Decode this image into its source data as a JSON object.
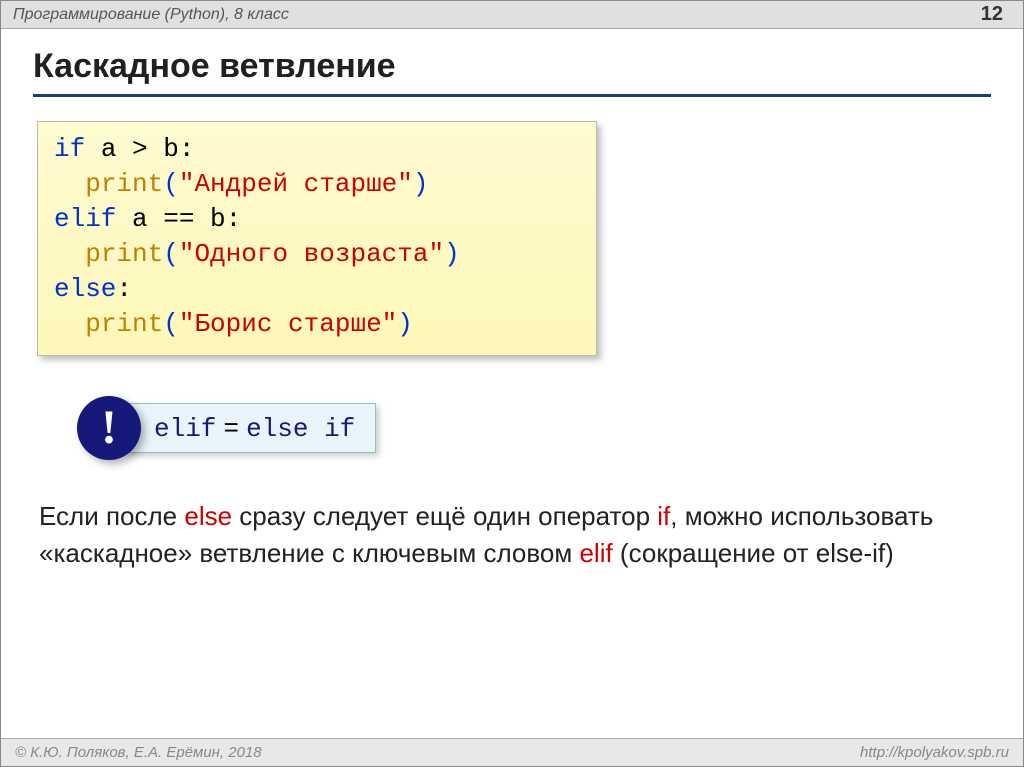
{
  "header": {
    "title": "Программирование (Python), 8 класс",
    "page": "12"
  },
  "title": "Каскадное ветвление",
  "code": {
    "l1_kw": "if",
    "l1_rest": " a > b:",
    "l2_fn": "print",
    "l2_p1": "(",
    "l2_str": "\"Андрей старше\"",
    "l2_p2": ")",
    "l3_kw": "elif",
    "l3_rest": " a == b:",
    "l4_fn": "print",
    "l4_p1": "(",
    "l4_str": "\"Одного возраста\"",
    "l4_p2": ")",
    "l5_kw": "else",
    "l5_rest": ":",
    "l6_fn": "print",
    "l6_p1": "(",
    "l6_str": "\"Борис старше\"",
    "l6_p2": ")"
  },
  "note": {
    "bang": "!",
    "a": "elif",
    "eq": " = ",
    "b": "else if"
  },
  "explain": {
    "p1a": "Если после ",
    "p1b": "else",
    "p1c": " сразу следует ещё один оператор ",
    "p1d": "if",
    "p1e": ", можно использовать «каскадное» ветвление с ключевым словом ",
    "p1f": "elif",
    "p1g": " (сокращение от else-if)"
  },
  "footer": {
    "left": "© К.Ю. Поляков, Е.А. Ерёмин, 2018",
    "right": "http://kpolyakov.spb.ru"
  }
}
